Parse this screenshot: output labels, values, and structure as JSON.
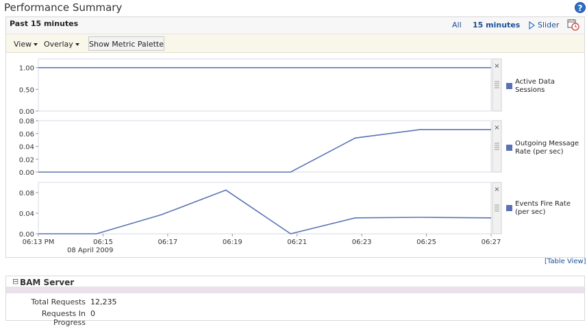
{
  "page": {
    "title": "Performance Summary",
    "help_glyph": "?"
  },
  "period": {
    "label": "Past 15 minutes",
    "all": "All",
    "current": "15 minutes",
    "slider": "Slider",
    "icons": {
      "slider": "play-triangle-icon",
      "refresh": "calendar-clock-icon",
      "help": "help-icon"
    }
  },
  "toolbar": {
    "view": "View",
    "overlay": "Overlay",
    "palette_button": "Show Metric Palette"
  },
  "colors": {
    "series": "#5a72b4",
    "link": "#1b4f96",
    "grid": "#d5d9e6"
  },
  "chart_data": {
    "type": "line",
    "x_tick_labels": [
      "06:13 PM",
      "06:15",
      "06:17",
      "06:19",
      "06:21",
      "06:23",
      "06:25",
      "06:27"
    ],
    "x_date_label": "08 April 2009",
    "x_time_range": [
      "06:13",
      "06:27"
    ],
    "panels": [
      {
        "name": "Active Data Sessions",
        "legend_lines": [
          "Active Data",
          "Sessions"
        ],
        "ylim": [
          0,
          1.2
        ],
        "yticks": [
          "1.00",
          "0.50",
          "0.00"
        ],
        "ytick_values": [
          1.0,
          0.5,
          0.0
        ],
        "points": [
          [
            0,
            1.0
          ],
          [
            14,
            1.0
          ]
        ]
      },
      {
        "name": "Outgoing Message Rate (per sec)",
        "legend_lines": [
          "Outgoing Message",
          "Rate (per sec)"
        ],
        "ylim": [
          0,
          0.08
        ],
        "yticks": [
          "0.08",
          "0.06",
          "0.04",
          "0.02",
          "0.00"
        ],
        "ytick_values": [
          0.08,
          0.06,
          0.04,
          0.02,
          0.0
        ],
        "points": [
          [
            0,
            0
          ],
          [
            7.8,
            0
          ],
          [
            9.8,
            0.053
          ],
          [
            11.8,
            0.066
          ],
          [
            14,
            0.066
          ]
        ]
      },
      {
        "name": "Events Fire Rate (per sec)",
        "legend_lines": [
          "Events Fire Rate",
          "(per sec)"
        ],
        "ylim": [
          0,
          0.1
        ],
        "yticks": [
          "0.08",
          "0.04",
          "0.00"
        ],
        "ytick_values": [
          0.08,
          0.04,
          0.0
        ],
        "points": [
          [
            0,
            0
          ],
          [
            1.8,
            0
          ],
          [
            3.8,
            0.037
          ],
          [
            5.8,
            0.085
          ],
          [
            7.8,
            0
          ],
          [
            9.8,
            0.031
          ],
          [
            11.8,
            0.032
          ],
          [
            14,
            0.031
          ]
        ]
      }
    ]
  },
  "table_view": "[Table View]",
  "bam": {
    "title": "BAM Server",
    "collapse_glyph": "⊟",
    "stats": [
      {
        "label": "Total Requests",
        "value": "12,235"
      },
      {
        "label": "Requests In Progress",
        "value": "0"
      }
    ]
  }
}
